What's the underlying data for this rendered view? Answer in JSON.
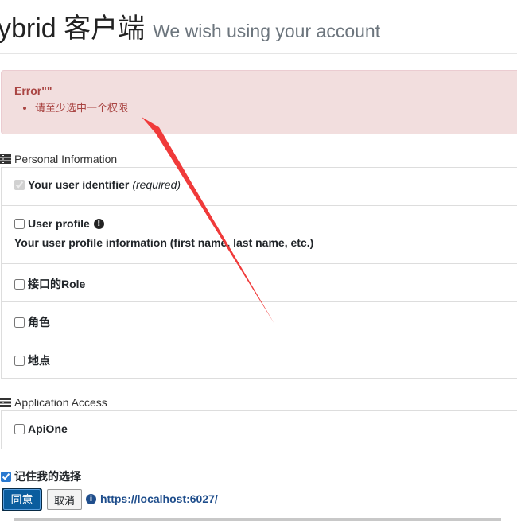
{
  "header": {
    "title": "ybrid 客户端",
    "subtitle": "We wish using your account"
  },
  "alert": {
    "title": "Error\"\"",
    "messages": [
      "请至少选中一个权限"
    ]
  },
  "personal": {
    "heading": "Personal Information",
    "items": [
      {
        "label": "Your user identifier",
        "note": "(required)",
        "checked": true,
        "disabled": true
      },
      {
        "label": "User profile",
        "description": "Your user profile information (first name, last name, etc.)",
        "checked": false
      },
      {
        "label": "接口的Role",
        "checked": false
      },
      {
        "label": "角色",
        "checked": false
      },
      {
        "label": "地点",
        "checked": false
      }
    ]
  },
  "application": {
    "heading": "Application Access",
    "items": [
      {
        "label": "ApiOne",
        "checked": false
      }
    ]
  },
  "remember": {
    "label": "记住我的选择",
    "checked": true
  },
  "buttons": {
    "consent": "同意",
    "cancel": "取消"
  },
  "client": {
    "url": "https://localhost:6027/"
  },
  "colors": {
    "alert_bg": "#f2dede",
    "alert_text": "#a94442",
    "primary": "#0b5d9e",
    "annotation_arrow": "#f03a3a"
  }
}
